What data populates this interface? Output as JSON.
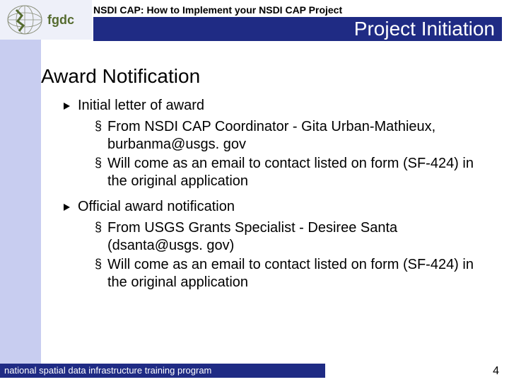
{
  "header": {
    "breadcrumb": "NSDI CAP: How to Implement your NSDI CAP Project",
    "title": "Project Initiation",
    "logo_text": "fgdc"
  },
  "main": {
    "heading": "Award Notification",
    "items": [
      {
        "label": "Initial letter of award",
        "sub": [
          "From NSDI CAP Coordinator - Gita Urban-Mathieux, burbanma@usgs. gov",
          "Will come as an email to contact listed on form (SF-424) in the original application"
        ]
      },
      {
        "label": "Official award notification",
        "sub": [
          "From USGS Grants Specialist - Desiree Santa (dsanta@usgs. gov)",
          "Will come as an email to contact listed on form (SF-424) in the original application"
        ]
      }
    ]
  },
  "footer": {
    "text": "national spatial data infrastructure training program",
    "page": "4"
  }
}
